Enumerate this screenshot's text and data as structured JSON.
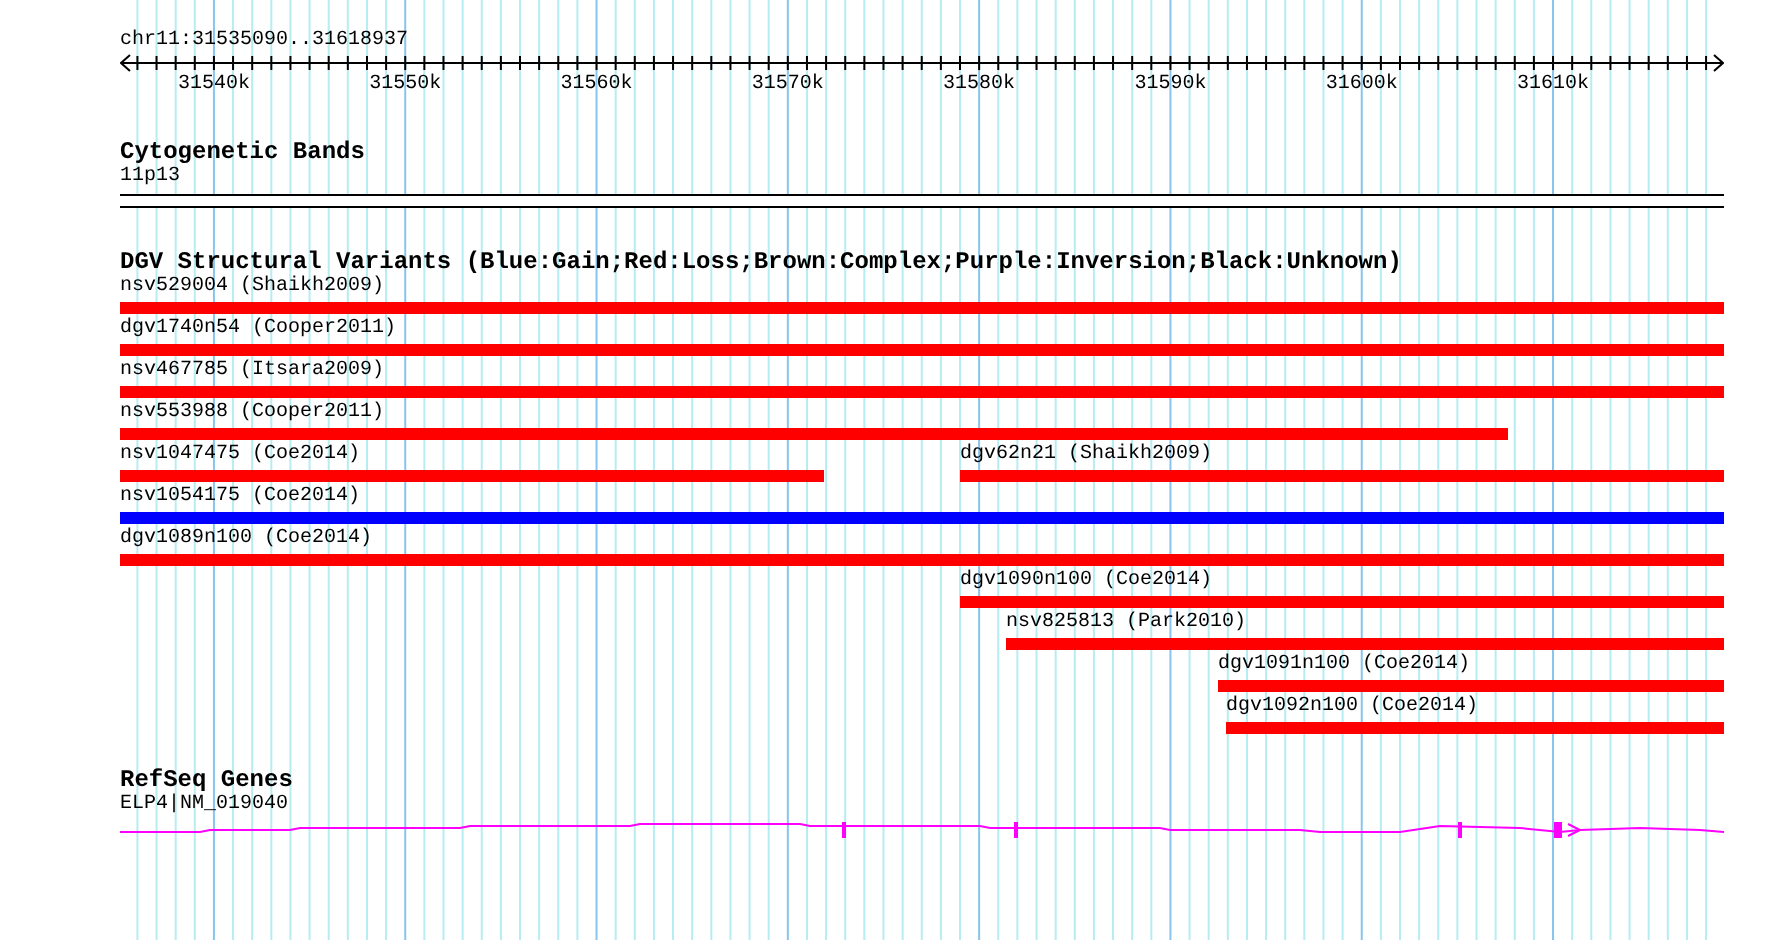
{
  "ruler": {
    "position": "chr11:31535090..31618937",
    "ticks": [
      "31540k",
      "31550k",
      "31560k",
      "31570k",
      "31580k",
      "31590k",
      "31600k",
      "31610k"
    ]
  },
  "cytoband_track": {
    "title": "Cytogenetic Bands",
    "band": "11p13"
  },
  "dgv_track": {
    "title": "DGV Structural Variants (Blue:Gain;Red:Loss;Brown:Complex;Purple:Inversion;Black:Unknown)",
    "rows": [
      [
        {
          "label": "nsv529004 (Shaikh2009)",
          "color": "#ff0000"
        }
      ],
      [
        {
          "label": "dgv1740n54 (Cooper2011)",
          "color": "#ff0000"
        }
      ],
      [
        {
          "label": "nsv467785 (Itsara2009)",
          "color": "#ff0000"
        }
      ],
      [
        {
          "label": "nsv553988 (Cooper2011)",
          "color": "#ff0000"
        }
      ],
      [
        {
          "label": "nsv1047475 (Coe2014)",
          "color": "#ff0000"
        },
        {
          "label": "dgv62n21 (Shaikh2009)",
          "color": "#ff0000"
        }
      ],
      [
        {
          "label": "nsv1054175 (Coe2014)",
          "color": "#0000ff"
        }
      ],
      [
        {
          "label": "dgv1089n100 (Coe2014)",
          "color": "#ff0000"
        }
      ],
      [
        {
          "label": "dgv1090n100 (Coe2014)",
          "color": "#ff0000"
        }
      ],
      [
        {
          "label": "nsv825813 (Park2010)",
          "color": "#ff0000"
        }
      ],
      [
        {
          "label": "dgv1091n100 (Coe2014)",
          "color": "#ff0000"
        }
      ],
      [
        {
          "label": "dgv1092n100 (Coe2014)",
          "color": "#ff0000"
        }
      ]
    ]
  },
  "refseq_track": {
    "title": "RefSeq Genes",
    "gene": "ELP4|NM_019040"
  }
}
